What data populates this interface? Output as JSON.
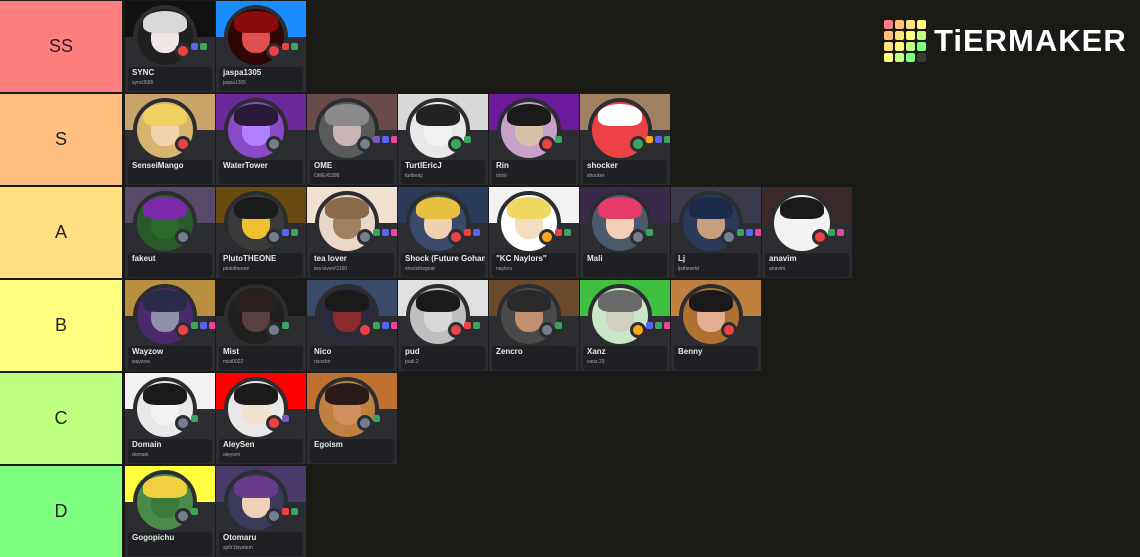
{
  "logo": {
    "text": "TiERMAKER",
    "grid_colors": [
      "#ff7f7f",
      "#ffbf7f",
      "#ffdf7f",
      "#ffff7f",
      "#ffbf7f",
      "#ffdf7f",
      "#ffff7f",
      "#bfff7f",
      "#ffdf7f",
      "#ffff7f",
      "#bfff7f",
      "#7fff7f",
      "#ffff7f",
      "#bfff7f",
      "#7fff7f",
      "#3a3a3a"
    ]
  },
  "tiers": [
    {
      "label": "SS",
      "color": "#ff7f7f",
      "items": [
        {
          "name": "SYNC",
          "handle": "sync0585",
          "banner": "#111111",
          "hair": "#d9d9d9",
          "skin": "#f2e6e6",
          "ring": "#202020",
          "status": "#ed4245",
          "badges": [
            "#5865f2",
            "#3ba55d"
          ]
        },
        {
          "name": "jaspa1305",
          "handle": "jaspa1305",
          "banner": "#1a8cff",
          "hair": "#8b0b0b",
          "skin": "#e05050",
          "ring": "#300505",
          "status": "#ed4245",
          "badges": [
            "#ed4245",
            "#3ba55d"
          ]
        }
      ]
    },
    {
      "label": "S",
      "color": "#ffbf7f",
      "items": [
        {
          "name": "SenseiMango",
          "handle": "",
          "banner": "#c9a46a",
          "hair": "#f0d060",
          "skin": "#f3d2b0",
          "ring": "#d8b56f",
          "status": "#ed4245",
          "badges": []
        },
        {
          "name": "WaterTower",
          "handle": "",
          "banner": "#6a2a9a",
          "hair": "#2a1a3a",
          "skin": "#b080ff",
          "ring": "#8a4ac8",
          "status": "#747f8d",
          "badges": []
        },
        {
          "name": "OME",
          "handle": "OME#5398",
          "banner": "#6a4a4a",
          "hair": "#8a8a8a",
          "skin": "#c8b4b4",
          "ring": "#5a5a5a",
          "status": "#747f8d",
          "badges": [
            "#7e57c2",
            "#5865f2",
            "#eb459e"
          ]
        },
        {
          "name": "TurtlEricJ",
          "handle": "turtlericj",
          "banner": "#d8d8d8",
          "hair": "#222222",
          "skin": "#f2f2f2",
          "ring": "#e8e8e8",
          "status": "#3ba55d",
          "badges": [
            "#3ba55d"
          ]
        },
        {
          "name": "Rin",
          "handle": "rinlol",
          "banner": "#6a1a9a",
          "hair": "#1a1a1a",
          "skin": "#d8c0a8",
          "ring": "#c8a0c8",
          "status": "#ed4245",
          "badges": [
            "#3ba55d"
          ]
        },
        {
          "name": "shocker",
          "handle": "shocker",
          "banner": "#a08060",
          "hair": "#ffffff",
          "skin": "#ed4245",
          "ring": "#ed4245",
          "status": "#3ba55d",
          "badges": [
            "#faa61a",
            "#5865f2",
            "#3ba55d"
          ]
        }
      ]
    },
    {
      "label": "A",
      "color": "#ffdf7f",
      "items": [
        {
          "name": "fakeut",
          "handle": "",
          "banner": "#5a4a6a",
          "hair": "#7a2aaa",
          "skin": "#2a6a2a",
          "ring": "#2a5a2a",
          "status": "#747f8d",
          "badges": []
        },
        {
          "name": "PlutoTHEONE",
          "handle": "plutotheone",
          "banner": "#6a4a10",
          "hair": "#1a1a1a",
          "skin": "#f0c030",
          "ring": "#3a3a3a",
          "status": "#747f8d",
          "badges": [
            "#5865f2",
            "#3ba55d"
          ]
        },
        {
          "name": "tea lover",
          "handle": "tea lover#3160",
          "banner": "#f0e0d0",
          "hair": "#8a6a4a",
          "skin": "#a08060",
          "ring": "#e8d8c8",
          "status": "#747f8d",
          "badges": [
            "#3ba55d",
            "#5865f2",
            "#eb459e"
          ]
        },
        {
          "name": "Shock (Future Gohan Arc)",
          "handle": "shockthegoat",
          "banner": "#2a3a5a",
          "hair": "#e8c040",
          "skin": "#f0d0b0",
          "ring": "#3a4a6a",
          "status": "#ed4245",
          "badges": [
            "#ed4245",
            "#5865f2"
          ]
        },
        {
          "name": "\"KC Naylors\"",
          "handle": "naylors",
          "banner": "#f2f2f2",
          "hair": "#f0d860",
          "skin": "#f3dcc0",
          "ring": "#ffffff",
          "status": "#faa61a",
          "badges": [
            "#ed4245",
            "#3ba55d"
          ]
        },
        {
          "name": "Mali",
          "handle": "",
          "banner": "#3a2a4a",
          "hair": "#e83a6a",
          "skin": "#f2d0b8",
          "ring": "#4a5a6a",
          "status": "#747f8d",
          "badges": [
            "#3ba55d"
          ]
        },
        {
          "name": "Lj",
          "handle": "ljsthewrld",
          "banner": "#3a3a4a",
          "hair": "#1a2a4a",
          "skin": "#c8a080",
          "ring": "#2a3a5a",
          "status": "#747f8d",
          "badges": [
            "#3ba55d",
            "#5865f2",
            "#eb459e"
          ]
        },
        {
          "name": "anavim",
          "handle": "anavim",
          "banner": "#3a2a2a",
          "hair": "#1a1a1a",
          "skin": "#f2f2f2",
          "ring": "#f2f2f2",
          "status": "#ed4245",
          "badges": [
            "#3ba55d",
            "#eb459e"
          ]
        }
      ]
    },
    {
      "label": "B",
      "color": "#ffff7f",
      "items": [
        {
          "name": "Wayzow",
          "handle": "wayzow",
          "banner": "#b89040",
          "hair": "#2a2a4a",
          "skin": "#9090a8",
          "ring": "#4a2a6a",
          "status": "#ed4245",
          "badges": [
            "#3ba55d",
            "#5865f2",
            "#eb459e"
          ]
        },
        {
          "name": "Mist",
          "handle": "mist0022",
          "banner": "#1a1a1a",
          "hair": "#2a2020",
          "skin": "#5a4040",
          "ring": "#202020",
          "status": "#747f8d",
          "badges": [
            "#3ba55d"
          ]
        },
        {
          "name": "Nico",
          "handle": "nicorbn",
          "banner": "#3a4a6a",
          "hair": "#1a1a1a",
          "skin": "#8a2a2a",
          "ring": "#2a2a3a",
          "status": "#ed4245",
          "badges": [
            "#3ba55d",
            "#5865f2",
            "#eb459e"
          ]
        },
        {
          "name": "pud",
          "handle": "pudi.2",
          "banner": "#e0e0e0",
          "hair": "#1a1a1a",
          "skin": "#d8d8d8",
          "ring": "#bfbfbf",
          "status": "#ed4245",
          "badges": [
            "#ed4245",
            "#3ba55d"
          ]
        },
        {
          "name": "Zencro",
          "handle": "",
          "banner": "#6a4a2a",
          "hair": "#2a2a2a",
          "skin": "#c09070",
          "ring": "#4a4a4a",
          "status": "#747f8d",
          "badges": [
            "#3ba55d"
          ]
        },
        {
          "name": "Xanz",
          "handle": "xanz.23",
          "banner": "#40c040",
          "hair": "#6a6a6a",
          "skin": "#d0d0c0",
          "ring": "#c8e8c8",
          "status": "#faa61a",
          "badges": [
            "#5865f2",
            "#3ba55d",
            "#eb459e"
          ]
        },
        {
          "name": "Benny",
          "handle": "",
          "banner": "#c08040",
          "hair": "#1a1a1a",
          "skin": "#e0b090",
          "ring": "#b07030",
          "status": "#ed4245",
          "badges": []
        }
      ]
    },
    {
      "label": "C",
      "color": "#bfff7f",
      "items": [
        {
          "name": "Domain",
          "handle": "domain",
          "banner": "#f2f2f2",
          "hair": "#1a1a1a",
          "skin": "#f2f2f2",
          "ring": "#e8e8e8",
          "status": "#747f8d",
          "badges": [
            "#3ba55d"
          ]
        },
        {
          "name": "AleySen",
          "handle": "aleysen",
          "banner": "#ff0000",
          "hair": "#1a1a1a",
          "skin": "#f2e0d0",
          "ring": "#e8e8e8",
          "status": "#ed4245",
          "badges": [
            "#7e57c2"
          ]
        },
        {
          "name": "Egoism",
          "handle": "",
          "banner": "#c07030",
          "hair": "#2a1a1a",
          "skin": "#d09060",
          "ring": "#c08040",
          "status": "#747f8d",
          "badges": [
            "#3ba55d"
          ]
        }
      ]
    },
    {
      "label": "D",
      "color": "#7fff7f",
      "items": [
        {
          "name": "Gogopichu",
          "handle": "",
          "banner": "#ffff40",
          "hair": "#f0d040",
          "skin": "#3a7a3a",
          "ring": "#4a8a4a",
          "status": "#747f8d",
          "badges": [
            "#3ba55d"
          ]
        },
        {
          "name": "Otomaru",
          "handle": "sp0r1tsystem",
          "banner": "#4a3a6a",
          "hair": "#6a3a8a",
          "skin": "#f0d0b8",
          "ring": "#3a3a5a",
          "status": "#747f8d",
          "badges": [
            "#ed4245",
            "#3ba55d"
          ]
        }
      ]
    }
  ]
}
